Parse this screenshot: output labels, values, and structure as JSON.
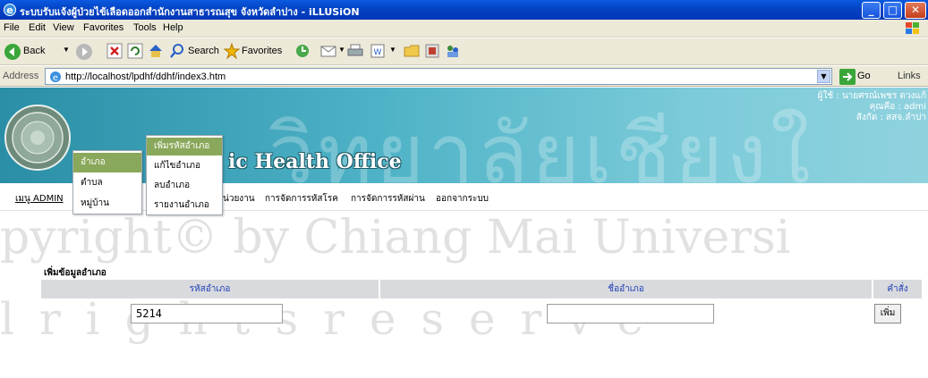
{
  "window": {
    "title": "ระบบรับแจ้งผู้ป่วยไข้เลือดออกสำนักงานสาธารณสุข จังหวัดลำปาง - iLLUSiON",
    "controls": [
      "minimize",
      "maximize",
      "close"
    ]
  },
  "menubar": [
    "File",
    "Edit",
    "View",
    "Favorites",
    "Tools",
    "Help"
  ],
  "toolbar": {
    "back_label": "Back",
    "search_label": "Search",
    "favorites_label": "Favorites"
  },
  "address": {
    "label": "Address",
    "url": "http://localhost/lpdhf/ddhf/index3.htm",
    "go_label": "Go",
    "links_label": "Links"
  },
  "banner": {
    "title_visible": "ic Health Office",
    "watermark": "วิทยาลัยเชียงใ",
    "user_lines": [
      "ผู้ใช้ : นายศรณ์เพชร ดวงแก้",
      "คุณคือ : admi",
      "สังกัด : สสจ.ลำปา"
    ]
  },
  "nav": {
    "admin_label": "เมนู ADMIN",
    "items": [
      "น่วยงาน",
      "การจัดการรหัสโรค",
      "การจัดการรหัสผ่าน",
      "ออกจากระบบ"
    ]
  },
  "menu_level1": [
    "อำเภอ",
    "ตำบล",
    "หมู่บ้าน"
  ],
  "menu_level2": [
    "เพิ่มรหัสอำเภอ",
    "แก้ไขอำเภอ",
    "ลบอำเภอ",
    "รายงานอำเภอ"
  ],
  "watermark": {
    "line1": "pyright© by Chiang Mai Universi",
    "line2": "l r i g h t s   r e s e r v e"
  },
  "form": {
    "section_title": "เพิ่มข้อมูลอำเภอ",
    "headers": [
      "รหัสอำเภอ",
      "ชื่ออำเภอ",
      "คำสั่ง"
    ],
    "code_value": "5214",
    "name_value": "",
    "add_button": "เพิ่ม"
  }
}
